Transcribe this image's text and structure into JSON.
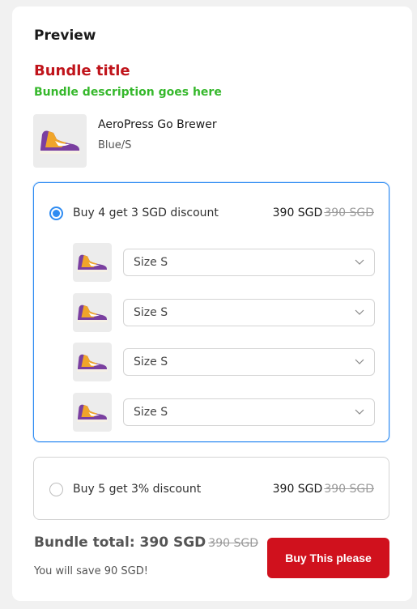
{
  "preview": {
    "title": "Preview"
  },
  "bundle": {
    "title": "Bundle title",
    "description": "Bundle description goes here"
  },
  "product": {
    "name": "AeroPress Go Brewer",
    "variant": "Blue/S"
  },
  "options": [
    {
      "label": "Buy 4 get 3 SGD discount",
      "price": "390 SGD",
      "compare_price": "390 SGD",
      "selected": true,
      "variants": [
        {
          "value": "Size S"
        },
        {
          "value": "Size S"
        },
        {
          "value": "Size S"
        },
        {
          "value": "Size S"
        }
      ]
    },
    {
      "label": "Buy 5 get 3% discount",
      "price": "390 SGD",
      "compare_price": "390 SGD",
      "selected": false
    }
  ],
  "summary": {
    "total_label": "Bundle total: 390 SGD",
    "total_compare": "390 SGD",
    "save_text": "You will save 90 SGD!"
  },
  "cta": {
    "label": "Buy This please"
  },
  "colors": {
    "accent": "#2f8cf2",
    "title": "#c0141b",
    "description": "#36b82c",
    "cta": "#d0111d"
  },
  "icons": {
    "product": "sneaker-icon",
    "dropdown": "chevron-down-icon"
  }
}
